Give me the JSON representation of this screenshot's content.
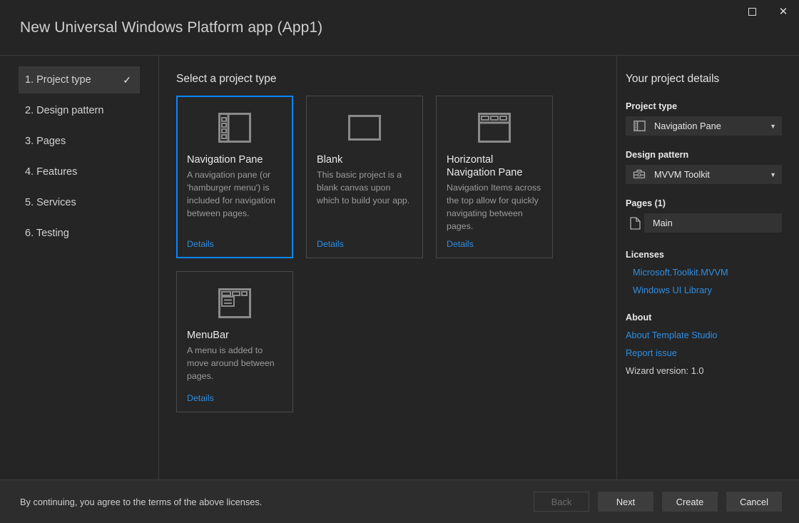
{
  "window": {
    "title": "New Universal Windows Platform app (App1)",
    "maximize_label": "Maximize",
    "close_label": "Close"
  },
  "sidebar": {
    "items": [
      {
        "label": "1. Project type",
        "active": true,
        "check": "✓"
      },
      {
        "label": "2. Design pattern",
        "active": false,
        "check": ""
      },
      {
        "label": "3. Pages",
        "active": false,
        "check": ""
      },
      {
        "label": "4. Features",
        "active": false,
        "check": ""
      },
      {
        "label": "5. Services",
        "active": false,
        "check": ""
      },
      {
        "label": "6. Testing",
        "active": false,
        "check": ""
      }
    ]
  },
  "main": {
    "heading": "Select a project type",
    "cards": [
      {
        "title": "Navigation Pane",
        "description": "A navigation pane (or 'hamburger menu') is included for navigation between pages.",
        "details_label": "Details",
        "icon": "navigation-pane-icon",
        "selected": true
      },
      {
        "title": "Blank",
        "description": "This basic project is a blank canvas upon which to build your app.",
        "details_label": "Details",
        "icon": "blank-window-icon",
        "selected": false
      },
      {
        "title": "Horizontal Navigation Pane",
        "description": "Navigation Items across the top allow for quickly navigating between pages.",
        "details_label": "Details",
        "icon": "horizontal-navigation-icon",
        "selected": false
      },
      {
        "title": "MenuBar",
        "description": "A menu is added to move around between pages.",
        "details_label": "Details",
        "icon": "menubar-icon",
        "selected": false
      }
    ]
  },
  "details": {
    "title": "Your project details",
    "project_type_label": "Project type",
    "project_type_value": "Navigation Pane",
    "project_type_icon": "navigation-pane-icon",
    "design_pattern_label": "Design pattern",
    "design_pattern_value": "MVVM Toolkit",
    "design_pattern_icon": "toolbox-icon",
    "pages_label": "Pages (1)",
    "pages": [
      {
        "name": "Main",
        "icon": "page-icon"
      }
    ],
    "licenses_label": "Licenses",
    "licenses": [
      "Microsoft.Toolkit.MVVM",
      "Windows UI Library"
    ],
    "about_label": "About",
    "about_links": [
      "About Template Studio",
      "Report issue"
    ],
    "version_text": "Wizard version: 1.0"
  },
  "footer": {
    "note": "By continuing, you agree to the terms of the above licenses.",
    "buttons": [
      {
        "label": "Back",
        "disabled": true
      },
      {
        "label": "Next",
        "disabled": false
      },
      {
        "label": "Create",
        "disabled": false
      },
      {
        "label": "Cancel",
        "disabled": false
      }
    ]
  },
  "colors": {
    "accent_blue": "#0a84ff",
    "link_blue": "#2f8ee0",
    "window_bg": "#252526",
    "footer_bg": "#2d2d2d",
    "card_bg": "#262626",
    "control_bg": "#333333"
  }
}
